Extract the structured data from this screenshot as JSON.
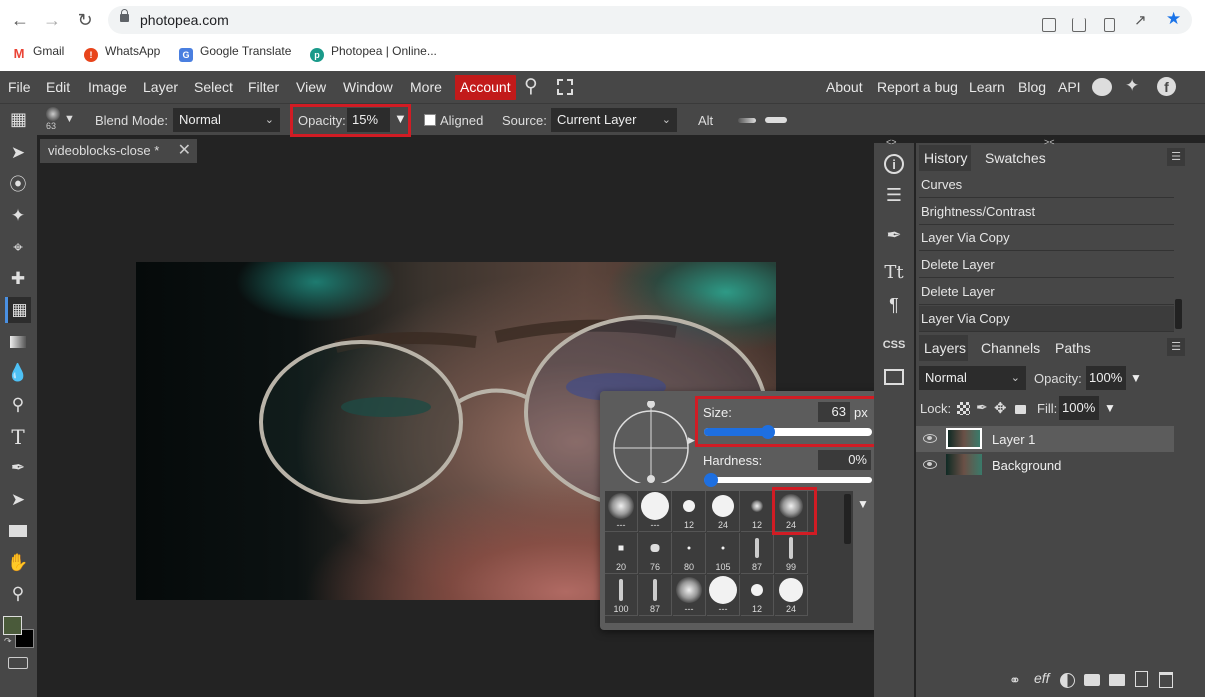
{
  "browser": {
    "url": "photopea.com",
    "bookmarks": [
      "Gmail",
      "WhatsApp",
      "Google Translate",
      "Photopea | Online..."
    ]
  },
  "menubar": {
    "items": [
      "File",
      "Edit",
      "Image",
      "Layer",
      "Select",
      "Filter",
      "View",
      "Window",
      "More"
    ],
    "account": "Account",
    "right_links": [
      "About",
      "Report a bug",
      "Learn",
      "Blog",
      "API"
    ]
  },
  "options": {
    "brush_size_small": "63",
    "blend_mode_label": "Blend Mode:",
    "blend_mode_value": "Normal",
    "opacity_label": "Opacity:",
    "opacity_value": "15%",
    "aligned_label": "Aligned",
    "source_label": "Source:",
    "source_value": "Current Layer",
    "alt_label": "Alt"
  },
  "document": {
    "tab_title": "videoblocks-close *"
  },
  "brush_popup": {
    "size_label": "Size:",
    "size_value": "63",
    "size_unit": "px",
    "size_fraction": 0.38,
    "hardness_label": "Hardness:",
    "hardness_value": "0%",
    "hardness_fraction": 0.0,
    "presets": [
      {
        "label": "---",
        "style": "soft",
        "size": 26
      },
      {
        "label": "---",
        "style": "hard",
        "size": 28
      },
      {
        "label": "12",
        "style": "hard",
        "size": 12
      },
      {
        "label": "24",
        "style": "hard",
        "size": 22
      },
      {
        "label": "12",
        "style": "soft",
        "size": 12
      },
      {
        "label": "24",
        "style": "soft",
        "size": 24
      },
      {
        "label": "20",
        "style": "square",
        "size": 5
      },
      {
        "label": "76",
        "style": "blob",
        "size": 9
      },
      {
        "label": "80",
        "style": "hard",
        "size": 3
      },
      {
        "label": "105",
        "style": "hard",
        "size": 3
      },
      {
        "label": "87",
        "style": "stroke",
        "size": 20
      },
      {
        "label": "99",
        "style": "stroke",
        "size": 22
      },
      {
        "label": "100",
        "style": "stroke",
        "size": 22
      },
      {
        "label": "87",
        "style": "stroke",
        "size": 22
      },
      {
        "label": "---",
        "style": "soft",
        "size": 26
      },
      {
        "label": "---",
        "style": "hard",
        "size": 28
      },
      {
        "label": "12",
        "style": "hard",
        "size": 12
      },
      {
        "label": "24",
        "style": "hard",
        "size": 24
      }
    ]
  },
  "history": {
    "tabs": [
      "History",
      "Swatches"
    ],
    "items": [
      "Curves",
      "Brightness/Contrast",
      "Layer Via Copy",
      "Delete Layer",
      "Delete Layer",
      "Layer Via Copy"
    ]
  },
  "layers": {
    "tabs": [
      "Layers",
      "Channels",
      "Paths"
    ],
    "blend_mode": "Normal",
    "opacity_label": "Opacity:",
    "opacity_value": "100%",
    "lock_label": "Lock:",
    "fill_label": "Fill:",
    "fill_value": "100%",
    "items": [
      "Layer 1",
      "Background"
    ],
    "footer_fx": "eff"
  },
  "colors": {
    "accent_red": "#c21a1a",
    "highlight_red": "#d11c24",
    "slider_blue": "#1e6fe0",
    "foreground_color": "#4a5a3a",
    "background_color": "#000000"
  }
}
